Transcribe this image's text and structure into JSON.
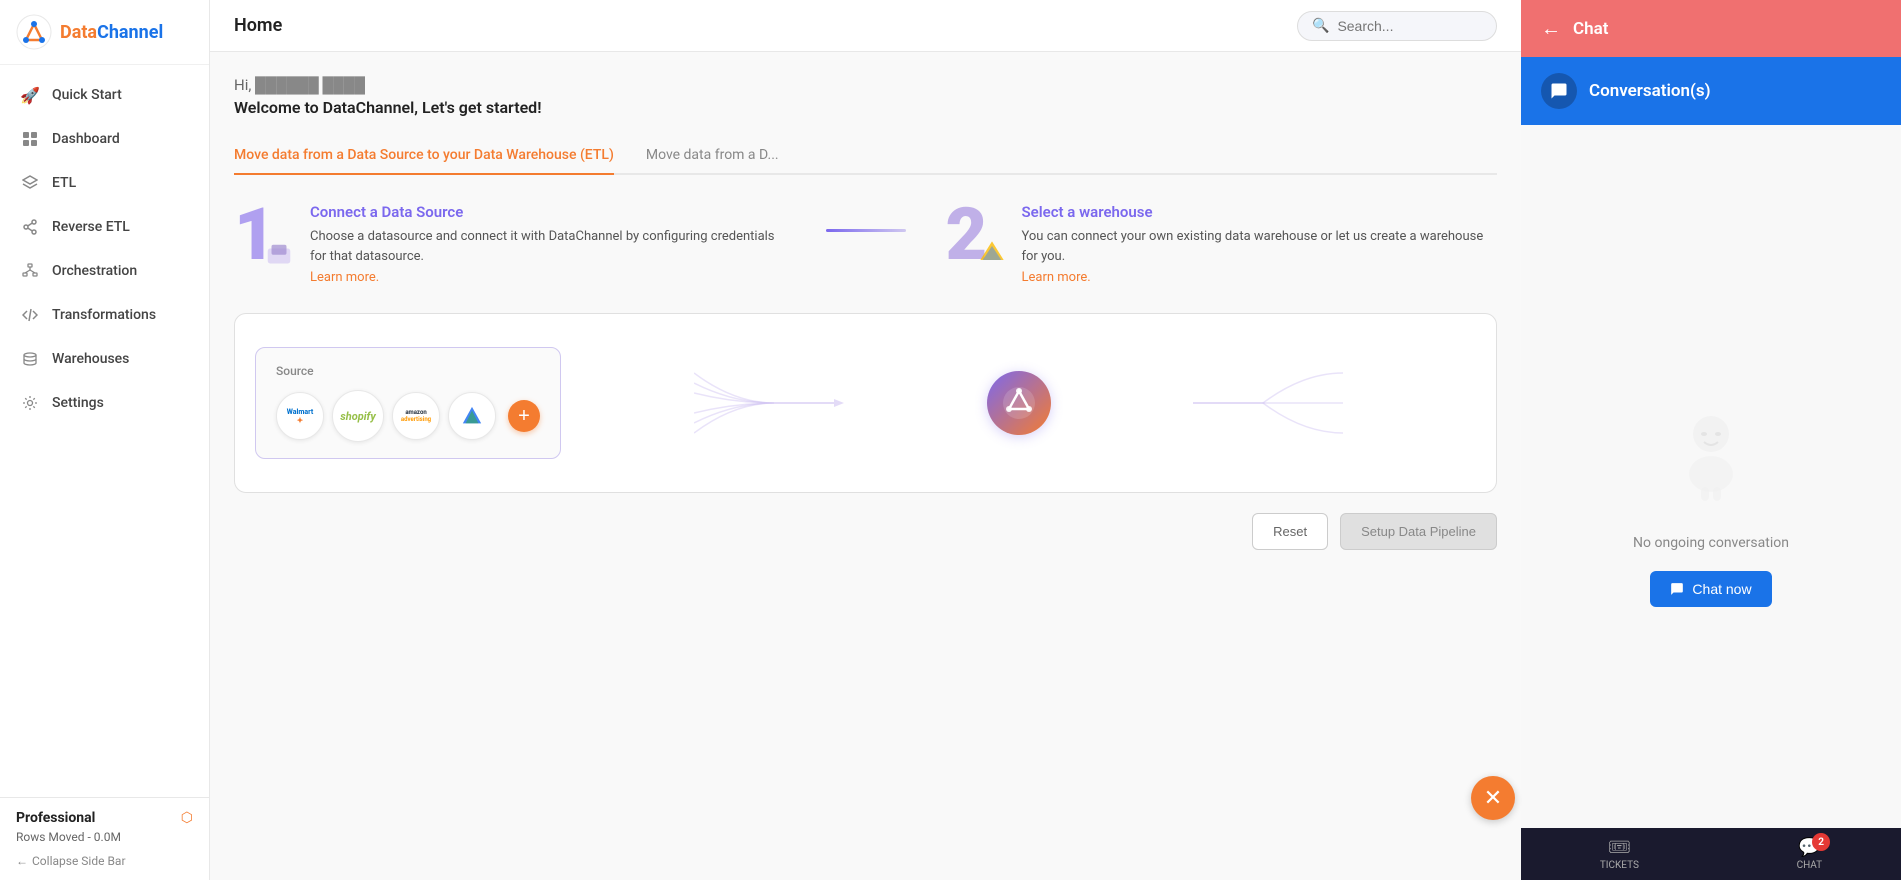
{
  "sidebar": {
    "logo": {
      "data_text": "Data",
      "channel_text": "Channel"
    },
    "nav_items": [
      {
        "id": "quick-start",
        "label": "Quick Start",
        "icon": "rocket"
      },
      {
        "id": "dashboard",
        "label": "Dashboard",
        "icon": "grid"
      },
      {
        "id": "etl",
        "label": "ETL",
        "icon": "layers"
      },
      {
        "id": "reverse-etl",
        "label": "Reverse ETL",
        "icon": "share"
      },
      {
        "id": "orchestration",
        "label": "Orchestration",
        "icon": "sitemap"
      },
      {
        "id": "transformations",
        "label": "Transformations",
        "icon": "code"
      },
      {
        "id": "warehouses",
        "label": "Warehouses",
        "icon": "database"
      },
      {
        "id": "settings",
        "label": "Settings",
        "icon": "gear"
      }
    ],
    "plan": {
      "name": "Professional",
      "rows_moved": "Rows Moved - 0.0M",
      "collapse_label": "Collapse Side Bar"
    }
  },
  "header": {
    "title": "Home",
    "search_placeholder": "Search..."
  },
  "greeting": {
    "hi": "Hi,",
    "username": "██████ ████",
    "welcome": "Welcome to DataChannel, Let's get started!"
  },
  "tabs": [
    {
      "id": "etl-tab",
      "label": "Move data from a Data Source to your Data Warehouse (ETL)",
      "active": true
    },
    {
      "id": "reverse-tab",
      "label": "Move data from a D...",
      "active": false
    }
  ],
  "steps": [
    {
      "number": "1",
      "title": "Connect a Data Source",
      "description": "Choose a datasource and connect it with DataChannel by configuring credentials for that datasource.",
      "link": "Learn more."
    },
    {
      "number": "2",
      "title": "Select a warehouse",
      "description": "You can connect your own existing data warehouse or let us create a warehouse for you.",
      "link": "Learn more."
    }
  ],
  "source_label": "Source",
  "sources": [
    {
      "id": "walmart",
      "label": "Walmart ✦"
    },
    {
      "id": "shopify",
      "label": "shopify"
    },
    {
      "id": "amazon-advertising",
      "label": "amazon advertising"
    },
    {
      "id": "google-ads",
      "label": "Google Ads"
    }
  ],
  "actions": {
    "reset": "Reset",
    "setup": "Setup Data Pipeline"
  },
  "chat": {
    "header_title": "Chat",
    "conversations_title": "Conversation(s)",
    "no_convo_text": "No ongoing conversation",
    "chat_now": "Chat now"
  },
  "bottom_bar": {
    "tickets_label": "TICKETS",
    "chat_label": "CHAT",
    "chat_badge": "2"
  }
}
